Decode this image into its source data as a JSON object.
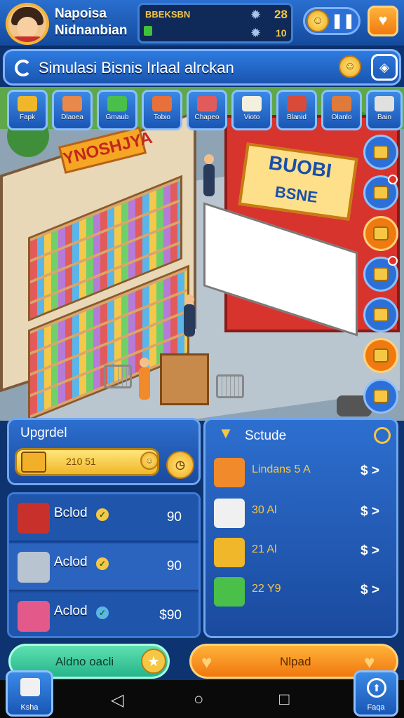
{
  "player": {
    "name_line1": "Napoisa",
    "name_line2": "Nidnanbian"
  },
  "resources": {
    "label": "BBEKSBN",
    "value1": "28",
    "value2": "10"
  },
  "title": "Simulasi Bisnis  Irlaal alrckan",
  "categories": [
    {
      "label": "Fapk",
      "color": "#f0b72a"
    },
    {
      "label": "Dlaoea",
      "color": "#e8884a"
    },
    {
      "label": "Gmaub",
      "color": "#4ac04a"
    },
    {
      "label": "Tobio",
      "color": "#e8703a"
    },
    {
      "label": "Chapeo",
      "color": "#e25b5b"
    },
    {
      "label": "Vioto",
      "color": "#f4f0e0"
    },
    {
      "label": "Blanid",
      "color": "#d84a3a"
    },
    {
      "label": "Olanlo",
      "color": "#e07a3a"
    },
    {
      "label": "Bain",
      "color": "#e0e0e0"
    }
  ],
  "scene": {
    "sign_left": "YNOSHJYA",
    "sign_right_top": "BUOBI",
    "sign_right_bottom": "BSNE"
  },
  "upgrade": {
    "title": "Upgrdel",
    "progress_text": "210 51"
  },
  "left_items": [
    {
      "name": "Bclod",
      "price": "90"
    },
    {
      "name": "Aclod",
      "price": "90"
    },
    {
      "name": "Aclod",
      "price": "$90"
    }
  ],
  "schedule": {
    "title": "Sctude",
    "rows": [
      {
        "text": "Lindans  5 A",
        "arrow": "$ >"
      },
      {
        "text": "30 Al",
        "arrow": "$ >"
      },
      {
        "text": "21 Al",
        "arrow": "$ >"
      },
      {
        "text": "22 Y9",
        "arrow": "$ >"
      }
    ]
  },
  "buttons": {
    "green": "Aldno oacli",
    "orange": "Nlpad",
    "corner_left": "Ksha",
    "corner_right": "Faqa"
  },
  "colors": {
    "accent": "#2c6fd6",
    "gold": "#f6c744",
    "orange": "#f07a10"
  }
}
